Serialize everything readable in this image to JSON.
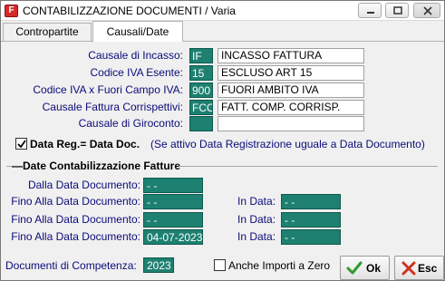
{
  "window": {
    "title": "CONTABILIZZAZIONE DOCUMENTI / Varia",
    "icon": "F"
  },
  "tabs": [
    "Contropartite",
    "Causali/Date"
  ],
  "fields": {
    "incasso": {
      "label": "Causale di Incasso:",
      "code": "IF",
      "desc": "INCASSO FATTURA"
    },
    "iva_esente": {
      "label": "Codice IVA Esente:",
      "code": "15",
      "desc": "ESCLUSO ART 15"
    },
    "iva_fuori": {
      "label": "Codice IVA x Fuori Campo IVA:",
      "code": "900",
      "desc": "FUORI AMBITO IVA"
    },
    "corrispettivi": {
      "label": "Causale Fattura Corrispettivi:",
      "code": "FCO",
      "desc": "FATT. COMP. CORRISP."
    },
    "giroconto": {
      "label": "Causale di Giroconto:",
      "code": "",
      "desc": ""
    }
  },
  "data_reg": {
    "label": "Data Reg.= Data Doc.",
    "note": "(Se attivo Data Registrazione uguale a Data Documento)",
    "checked": true
  },
  "group_title": "Date Contabilizzazione Fatture",
  "dates": {
    "dalla_label": "Dalla Data Documento:",
    "dalla_value": "- -",
    "fino_label": "Fino Alla Data Documento:",
    "in_data_label": "In Data:",
    "rows": [
      {
        "fino": "- -",
        "in_data": "- -"
      },
      {
        "fino": "- -",
        "in_data": "- -"
      },
      {
        "fino": "04-07-2023",
        "in_data": "- -"
      }
    ]
  },
  "competenza": {
    "label": "Documenti di Competenza:",
    "value": "2023"
  },
  "anche_importi": {
    "label": "Anche Importi a Zero",
    "checked": false
  },
  "buttons": {
    "ok": "Ok",
    "esc": "Esc"
  },
  "colors": {
    "field_teal": "#1e8070",
    "label_blue": "#0b0b7a",
    "ok_green": "#2e9a2e",
    "esc_red": "#d03020"
  }
}
